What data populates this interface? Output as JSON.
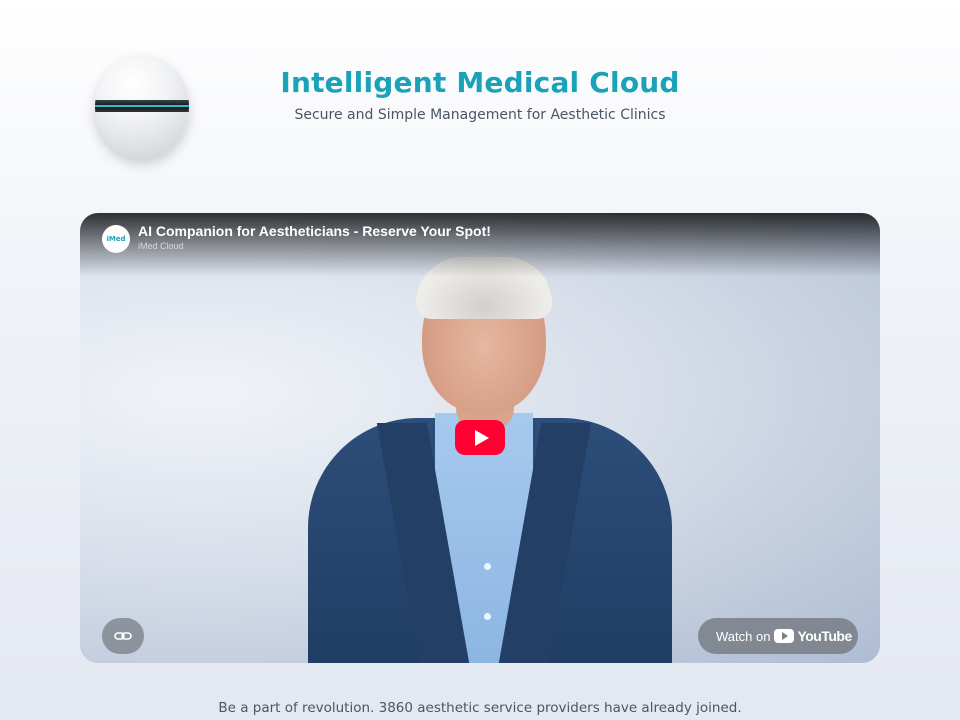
{
  "header": {
    "title": "Intelligent Medical Cloud",
    "subtitle": "Secure and Simple Management for Aesthetic Clinics",
    "logo_icon": "orb-logo-icon"
  },
  "video": {
    "title": "AI Companion for Aestheticians - Reserve Your Spot!",
    "channel": "iMed Cloud",
    "channel_avatar_text": "iMed",
    "play_icon": "play-icon",
    "link_icon": "link-icon",
    "watch_label": "Watch on",
    "youtube_wordmark": "YouTube",
    "colors": {
      "play": "#ff0033",
      "title_accent": "#1aa2b8"
    }
  },
  "footer": {
    "text": "Be a part of revolution. 3860 aesthetic service providers have already joined."
  }
}
